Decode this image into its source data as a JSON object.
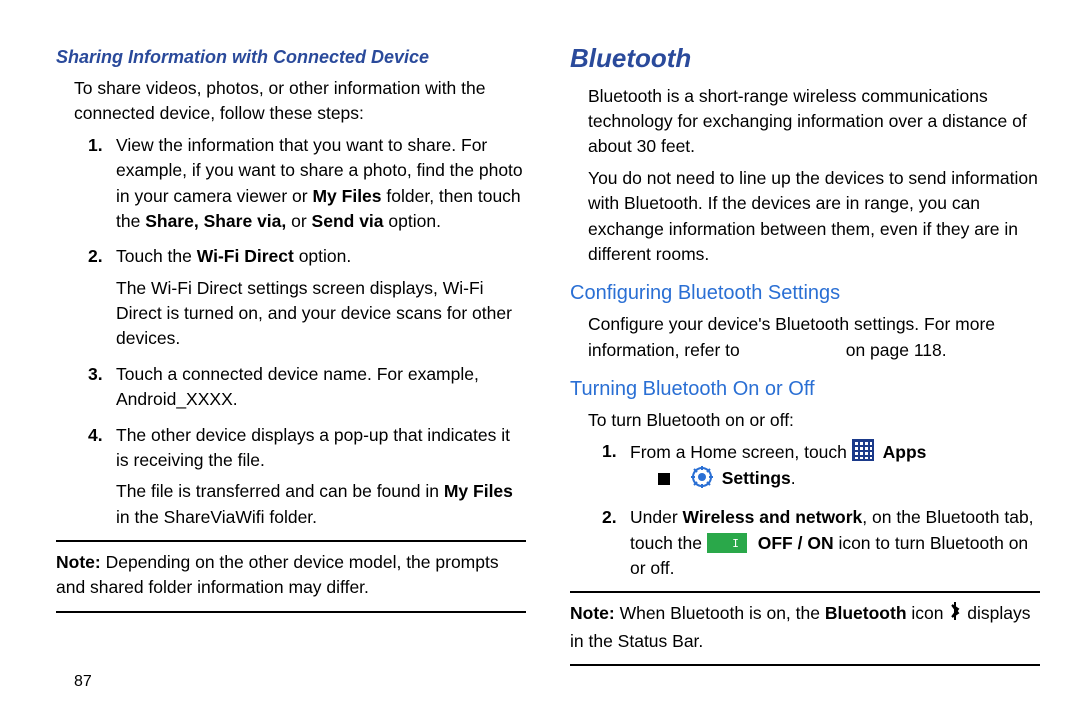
{
  "left": {
    "section_title": "Sharing Information with Connected Device",
    "intro1": "To share videos, photos, or other information with the connected device, follow these steps:",
    "step1_a": "View the information that you want to share. For example, if you want to share a photo, find the photo in your camera viewer or ",
    "step1_b_bold": "My Files",
    "step1_c": " folder, then touch the ",
    "step1_d_bold": "Share, Share via, ",
    "step1_e": "or",
    "step1_f_bold": " Send via ",
    "step1_g": "option.",
    "step2_a": "Touch the ",
    "step2_b_bold": "Wi-Fi Direct",
    "step2_c": " option.",
    "step2_sub": "The Wi-Fi Direct settings screen displays, Wi-Fi Direct is turned on, and your device scans for other devices.",
    "step3": "Touch a connected device name. For example, Android_XXXX.",
    "step4": "The other device displays a pop-up that indicates it is receiving the file.",
    "step4_sub_a": "The file is transferred and can be found in ",
    "step4_sub_b_bold": "My Files",
    "step4_sub_c": " in the ShareViaWifi folder.",
    "note_label": "Note: ",
    "note_body": "Depending on the other device model, the prompts and shared folder information may differ."
  },
  "right": {
    "title": "Bluetooth",
    "p1": "Bluetooth is a short-range wireless communications technology for exchanging information over a distance of about 30 feet.",
    "p2": "You do not need to line up the devices to send information with Bluetooth. If the devices are in range, you can exchange information between them, even if they are in different rooms.",
    "sub1": "Configuring Bluetooth Settings",
    "p3_a": "Configure your device's Bluetooth settings. For more information, refer to",
    "p3_b": "on page 118.",
    "sub2": "Turning Bluetooth On or Off",
    "p4": "To turn Bluetooth on or off:",
    "step1_a": "From a Home screen, touch ",
    "step1_apps": "Apps",
    "step1_settings": "Settings",
    "step1_dot": ".",
    "step2_a": "Under ",
    "step2_b_bold": "Wireless and network",
    "step2_c": ", on the Bluetooth tab, touch the ",
    "step2_d_bold": "OFF / ON",
    "step2_e": " icon to turn Bluetooth on or off.",
    "note_label": "Note: ",
    "note_a": "When Bluetooth is on, the ",
    "note_b_bold": "Bluetooth",
    "note_c": " icon ",
    "note_d": " displays in the Status Bar."
  },
  "page_number": "87"
}
